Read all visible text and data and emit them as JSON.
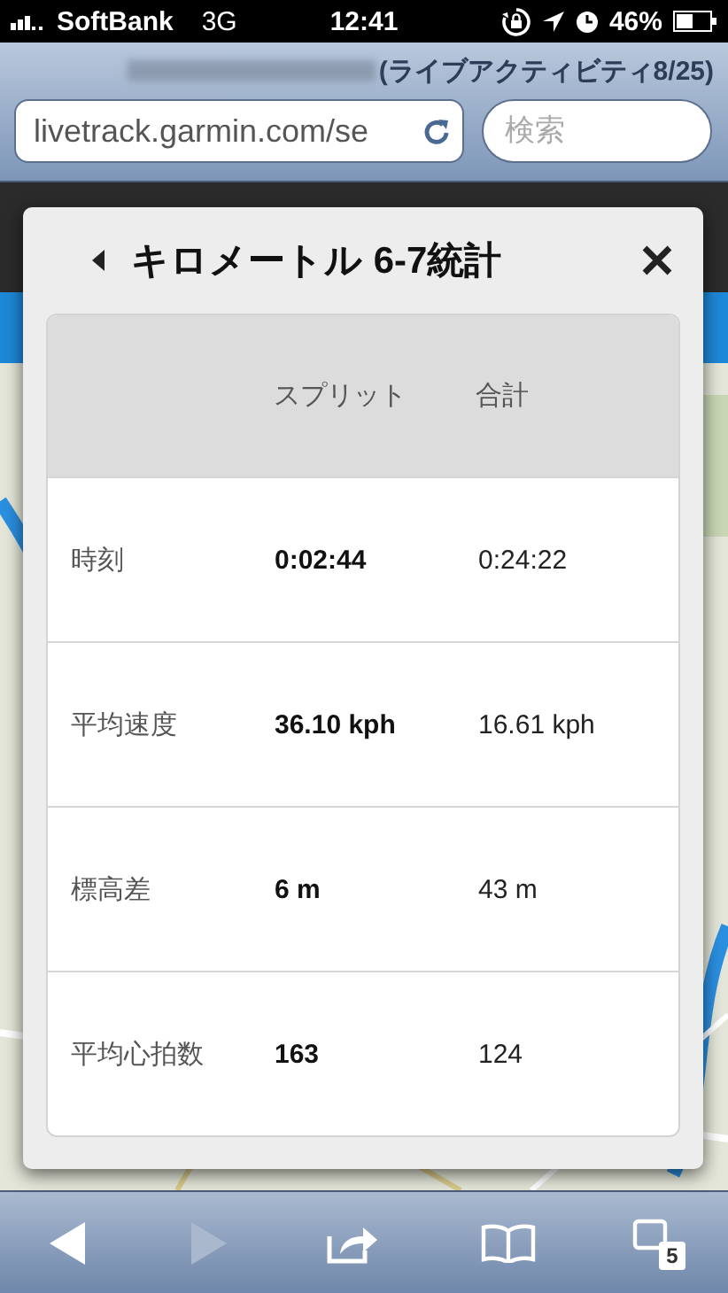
{
  "status_bar": {
    "carrier": "SoftBank",
    "network": "3G",
    "time": "12:41",
    "battery": "46%"
  },
  "browser": {
    "page_title": "(ライブアクティビティ8/25)",
    "url": "livetrack.garmin.com/se",
    "search": {
      "placeholder": "検索"
    }
  },
  "dialog": {
    "title": "キロメートル 6-7統計",
    "columns": [
      "スプリット",
      "合計"
    ],
    "rows": [
      {
        "label": "時刻",
        "split": "0:02:44",
        "total": "0:24:22"
      },
      {
        "label": "平均速度",
        "split": "36.10 kph",
        "total": "16.61 kph"
      },
      {
        "label": "標高差",
        "split": "6 m",
        "total": "43 m"
      },
      {
        "label": "平均心拍数",
        "split": "163",
        "total": "124"
      }
    ]
  },
  "toolbar": {
    "back": {
      "disabled": false
    },
    "forward": {
      "disabled": true
    },
    "tabs_count": "5"
  }
}
